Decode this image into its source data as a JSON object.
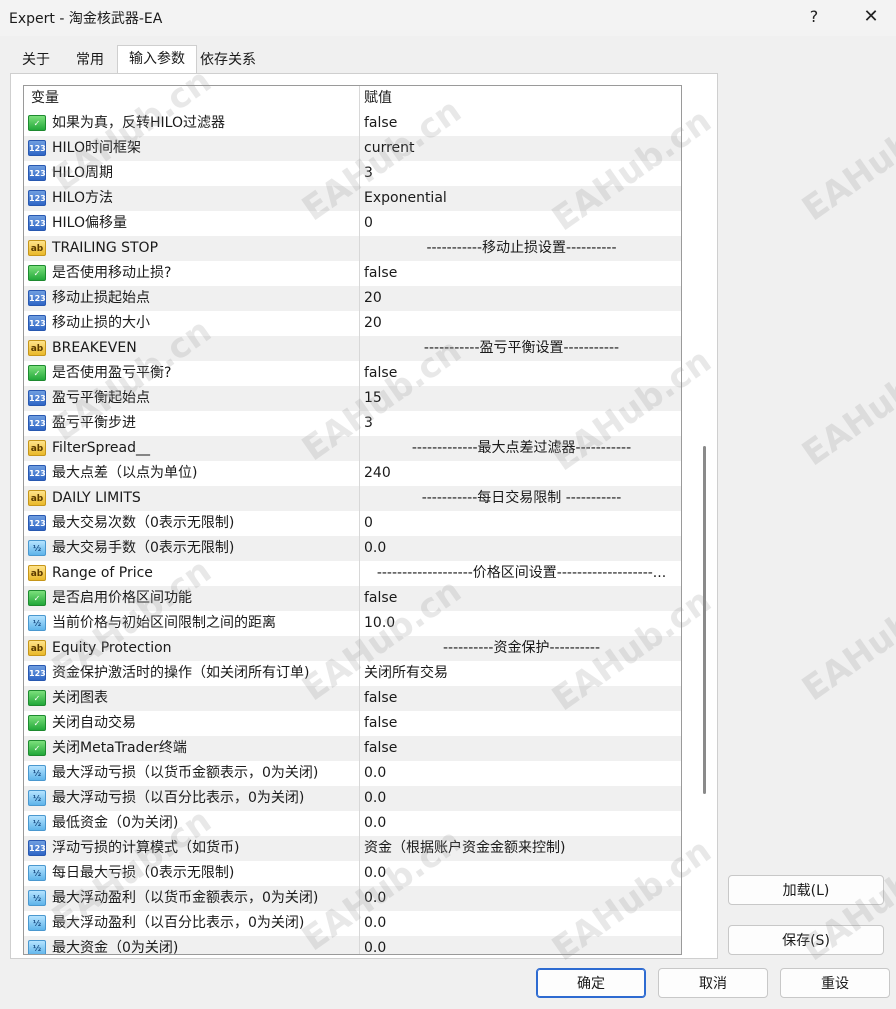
{
  "window": {
    "title": "Expert - 淘金核武器-EA",
    "help_symbol": "?",
    "close_symbol": "✕"
  },
  "tabs": [
    "关于",
    "常用",
    "输入参数",
    "依存关系"
  ],
  "grid": {
    "headers": {
      "variable": "变量",
      "value": "赋值"
    },
    "rows": [
      {
        "icon": "bool",
        "name": "如果为真，反转HILO过滤器",
        "value": "false"
      },
      {
        "icon": "num",
        "name": "HILO时间框架",
        "value": "current"
      },
      {
        "icon": "num",
        "name": "HILO周期",
        "value": "3"
      },
      {
        "icon": "num",
        "name": "HILO方法",
        "value": "Exponential"
      },
      {
        "icon": "num",
        "name": "HILO偏移量",
        "value": "0"
      },
      {
        "icon": "str",
        "name": "TRAILING STOP",
        "value": "-----------移动止损设置----------"
      },
      {
        "icon": "bool",
        "name": "是否使用移动止损?",
        "value": "false"
      },
      {
        "icon": "num",
        "name": "移动止损起始点",
        "value": "20"
      },
      {
        "icon": "num",
        "name": "移动止损的大小",
        "value": "20"
      },
      {
        "icon": "str",
        "name": "BREAKEVEN",
        "value": "-----------盈亏平衡设置-----------"
      },
      {
        "icon": "bool",
        "name": "是否使用盈亏平衡?",
        "value": "false"
      },
      {
        "icon": "num",
        "name": "盈亏平衡起始点",
        "value": "15"
      },
      {
        "icon": "num",
        "name": "盈亏平衡步进",
        "value": "3"
      },
      {
        "icon": "str",
        "name": "FilterSpread__",
        "value": "-------------最大点差过滤器-----------"
      },
      {
        "icon": "num",
        "name": "最大点差（以点为单位)",
        "value": "240"
      },
      {
        "icon": "str",
        "name": "DAILY LIMITS",
        "value": "-----------每日交易限制 -----------"
      },
      {
        "icon": "num",
        "name": "最大交易次数（0表示无限制)",
        "value": "0"
      },
      {
        "icon": "dbl",
        "name": "最大交易手数（0表示无限制)",
        "value": "0.0"
      },
      {
        "icon": "str",
        "name": "Range of Price",
        "value": "-------------------价格区间设置-------------------..."
      },
      {
        "icon": "bool",
        "name": "是否启用价格区间功能",
        "value": "false"
      },
      {
        "icon": "dbl",
        "name": "当前价格与初始区间限制之间的距离",
        "value": "10.0"
      },
      {
        "icon": "str",
        "name": "Equity Protection",
        "value": "----------资金保护----------"
      },
      {
        "icon": "num",
        "name": "资金保护激活时的操作（如关闭所有订单)",
        "value": "关闭所有交易"
      },
      {
        "icon": "bool",
        "name": "关闭图表",
        "value": "false"
      },
      {
        "icon": "bool",
        "name": "关闭自动交易",
        "value": "false"
      },
      {
        "icon": "bool",
        "name": "关闭MetaTrader终端",
        "value": "false"
      },
      {
        "icon": "dbl",
        "name": "最大浮动亏损（以货币金额表示，0为关闭)",
        "value": "0.0"
      },
      {
        "icon": "dbl",
        "name": "最大浮动亏损（以百分比表示，0为关闭)",
        "value": "0.0"
      },
      {
        "icon": "dbl",
        "name": "最低资金（0为关闭)",
        "value": "0.0"
      },
      {
        "icon": "num",
        "name": "浮动亏损的计算模式（如货币)",
        "value": "资金（根据账户资金金额来控制)"
      },
      {
        "icon": "dbl",
        "name": "每日最大亏损（0表示无限制)",
        "value": "0.0"
      },
      {
        "icon": "dbl",
        "name": "最大浮动盈利（以货币金额表示，0为关闭)",
        "value": "0.0"
      },
      {
        "icon": "dbl",
        "name": "最大浮动盈利（以百分比表示，0为关闭)",
        "value": "0.0"
      },
      {
        "icon": "dbl",
        "name": "最大资金（0为关闭)",
        "value": "0.0"
      }
    ]
  },
  "icons": {
    "num": "123",
    "bool": "✓",
    "str": "ab",
    "dbl": "½"
  },
  "side_buttons": {
    "load": "加载(L)",
    "save": "保存(S)"
  },
  "bottom_buttons": {
    "ok": "确定",
    "cancel": "取消",
    "reset": "重设"
  },
  "watermark": "EAHub.cn"
}
